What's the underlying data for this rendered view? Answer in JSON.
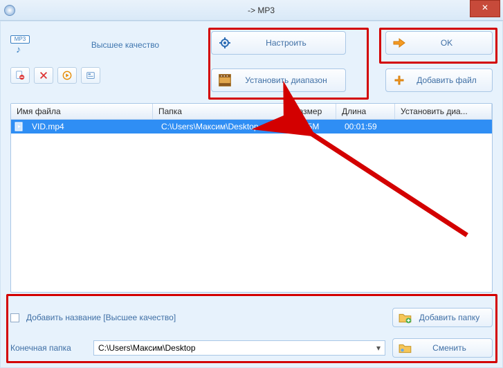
{
  "titlebar": {
    "title": "-> MP3"
  },
  "top": {
    "mp3_badge": "MP3",
    "quality_label": "Высшее качество",
    "configure_label": "Настроить",
    "set_range_label": "Установить диапазон",
    "ok_label": "OK",
    "add_file_label": "Добавить файл"
  },
  "columns": {
    "name": "Имя файла",
    "folder": "Папка",
    "size": "Размер",
    "length": "Длина",
    "range": "Установить диа..."
  },
  "rows": [
    {
      "name": "VID.mp4",
      "folder": "C:\\Users\\Максим\\Desktop",
      "size": "4.35M",
      "length": "00:01:59",
      "range": ""
    }
  ],
  "bottom": {
    "add_title_label": "Добавить название [Высшее качество]",
    "add_folder_label": "Добавить папку",
    "output_folder_label": "Конечная папка",
    "output_folder_value": "C:\\Users\\Максим\\Desktop",
    "change_label": "Сменить"
  }
}
